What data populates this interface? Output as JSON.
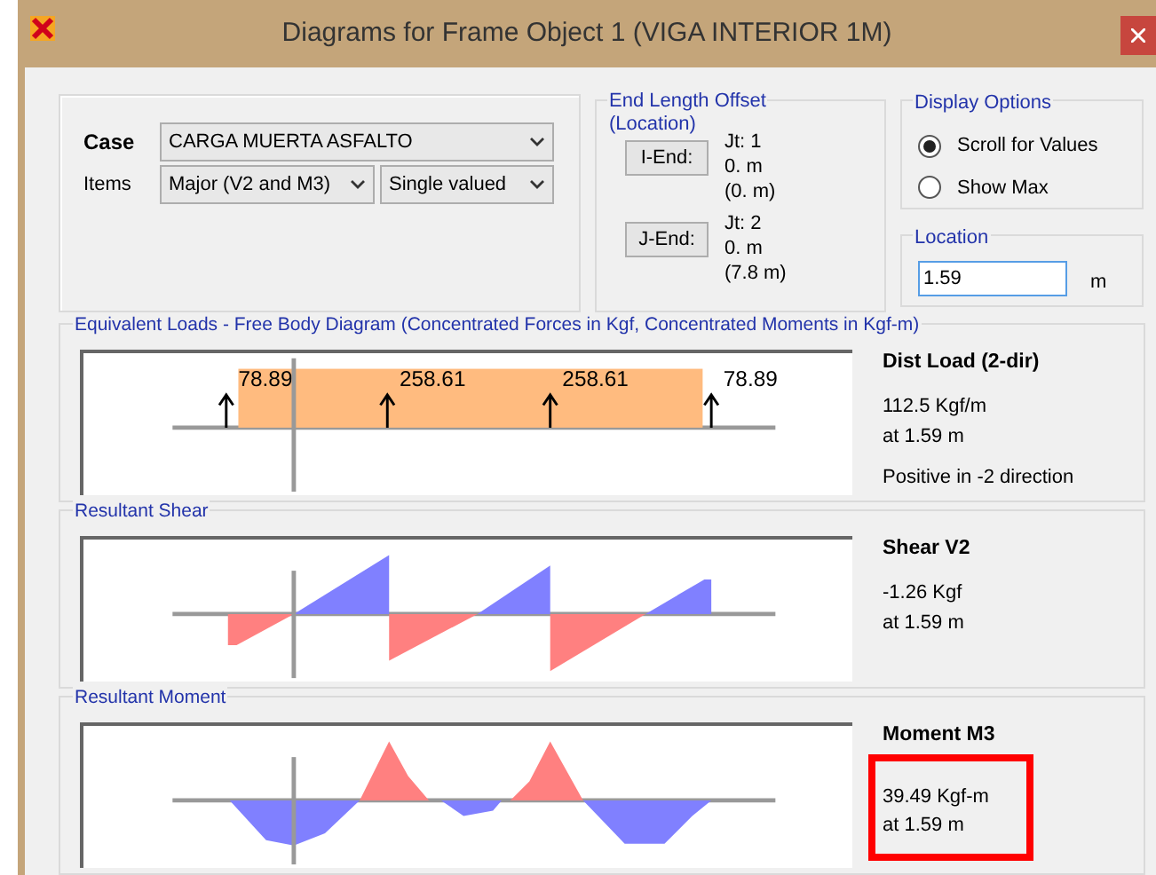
{
  "window": {
    "title": "Diagrams for Frame Object 1  (VIGA INTERIOR 1M)"
  },
  "case": {
    "label": "Case",
    "value": "CARGA MUERTA ASFALTO"
  },
  "items": {
    "label": "Items",
    "component": "Major (V2 and M3)",
    "mode": "Single valued"
  },
  "end_length_offset": {
    "title": "End Length Offset",
    "subtitle": "(Location)",
    "ends": [
      {
        "joint": "Jt:  1",
        "button": "I-End:",
        "offset": "0. m",
        "location": "(0. m)"
      },
      {
        "joint": "Jt:  2",
        "button": "J-End:",
        "offset": "0. m",
        "location": "(7.8 m)"
      }
    ]
  },
  "display_options": {
    "title": "Display Options",
    "options": [
      {
        "label": "Scroll for Values",
        "selected": true
      },
      {
        "label": "Show Max",
        "selected": false
      }
    ]
  },
  "location": {
    "title": "Location",
    "value": "1.59",
    "unit": "m"
  },
  "panels": [
    {
      "kind": "loads",
      "title": "Equivalent Loads - Free Body Diagram  (Concentrated Forces in Kgf, Concentrated Moments in Kgf-m)",
      "load_labels": [
        "78.89",
        "258.61",
        "258.61",
        "78.89"
      ],
      "heading": "Dist Load (2-dir)",
      "lines": [
        "112.5 Kgf/m",
        "at 1.59 m",
        "Positive in -2 direction"
      ],
      "highlighted": false
    },
    {
      "kind": "shear",
      "title": "Resultant Shear",
      "heading": "Shear V2",
      "lines": [
        "-1.26 Kgf",
        "at 1.59 m"
      ],
      "highlighted": false
    },
    {
      "kind": "moment",
      "title": "Resultant Moment",
      "heading": "Moment M3",
      "lines": [
        "39.49 Kgf-m",
        "at 1.59 m"
      ],
      "highlighted": true
    }
  ]
}
